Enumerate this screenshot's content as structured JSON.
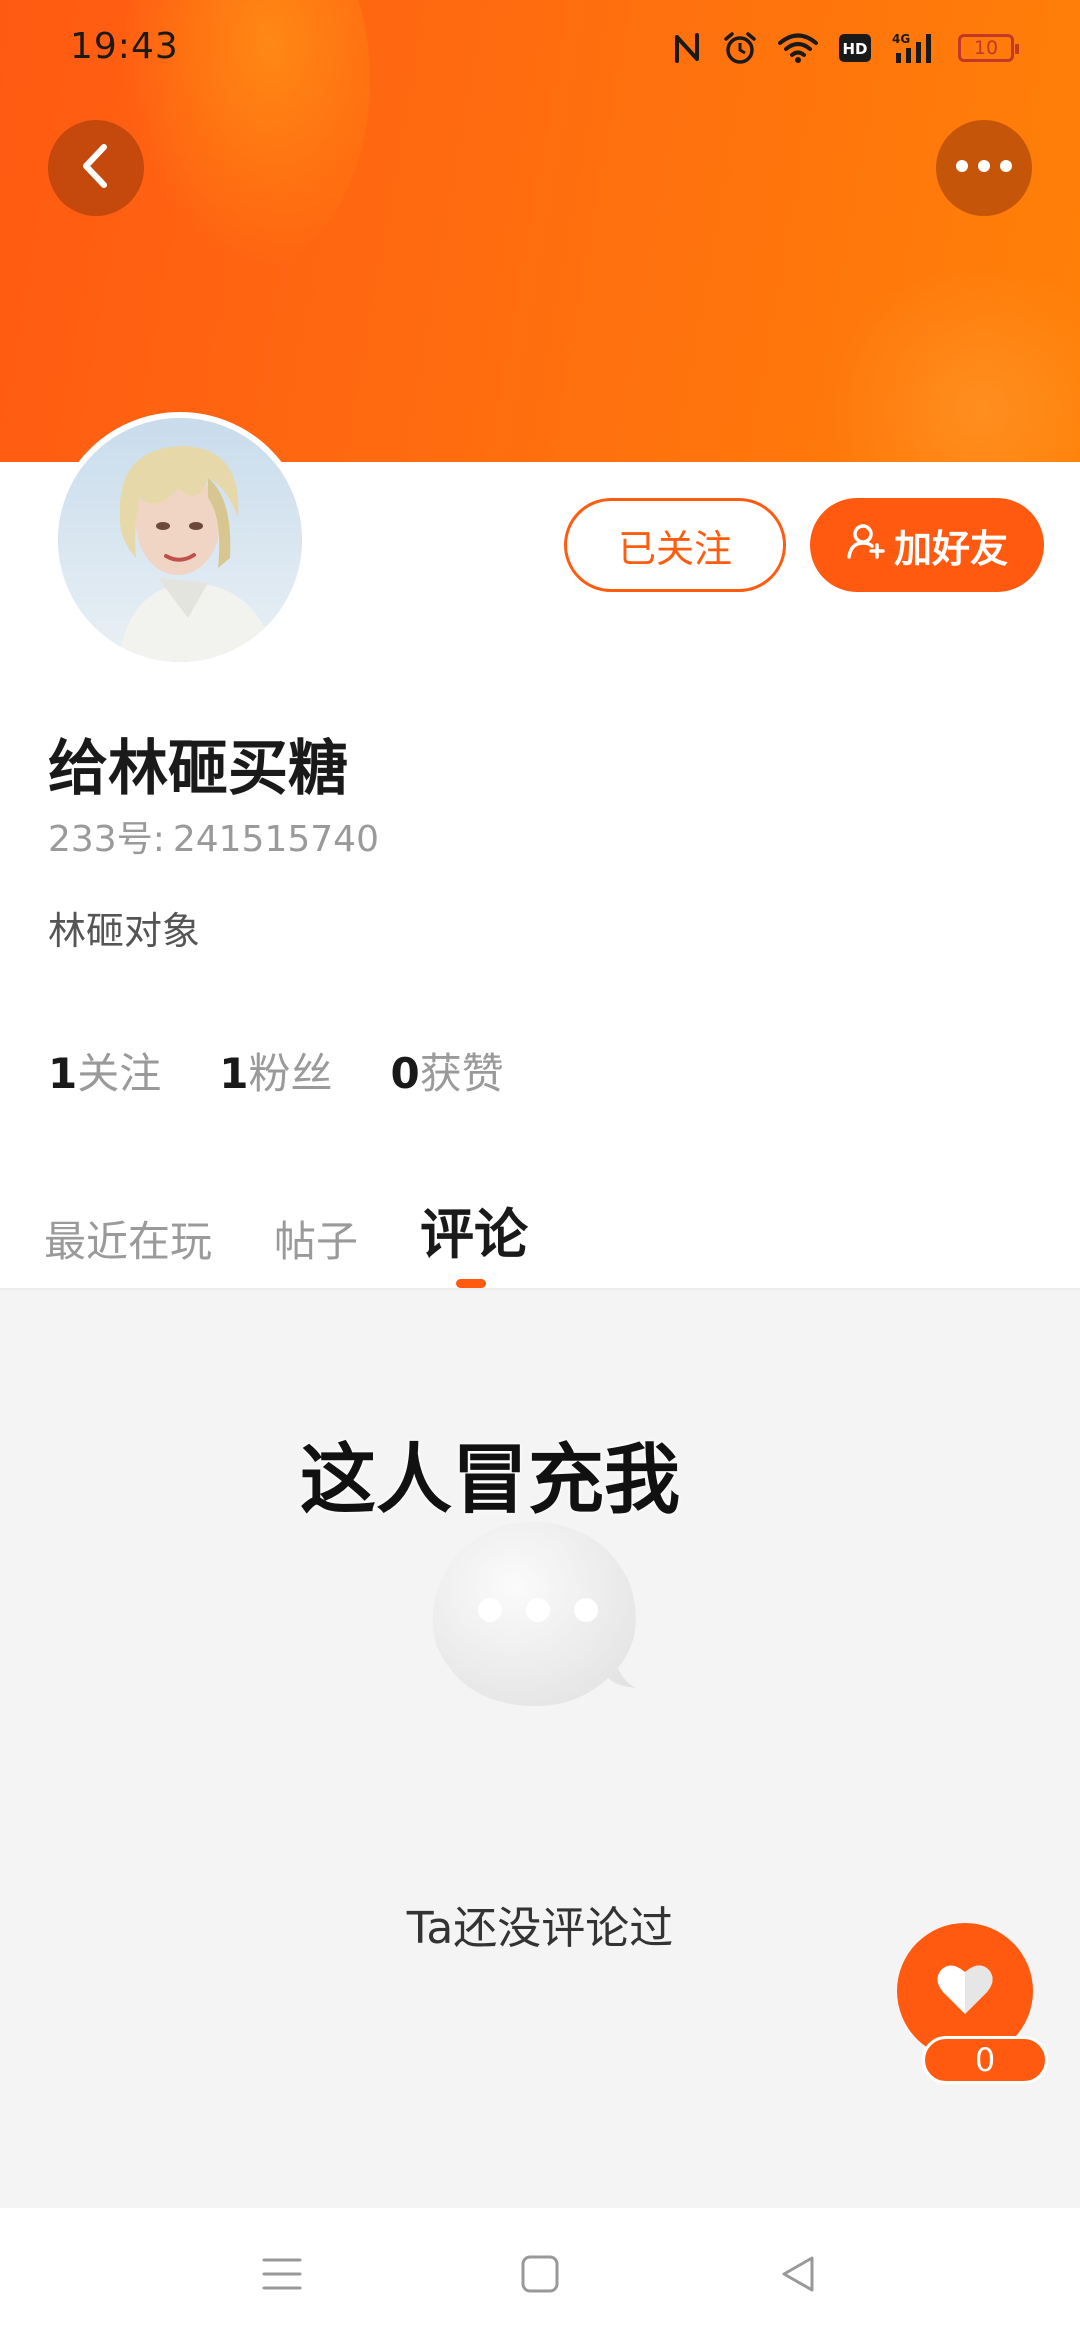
{
  "status_bar": {
    "time": "19:43",
    "battery": "10",
    "icons": [
      "nfc-icon",
      "alarm-icon",
      "wifi-icon",
      "hd-icon",
      "signal-4g-icon",
      "battery-icon"
    ]
  },
  "header": {
    "back_icon": "chevron-left-icon",
    "more_icon": "more-dots-icon",
    "banner_color": "#ff6a10"
  },
  "profile": {
    "username": "给林砸买糖",
    "id_label": "233号:",
    "id_value": "241515740",
    "bio": "林砸对象",
    "follow_button": "已关注",
    "add_friend_button": "加好友",
    "accent_color": "#ff5a10"
  },
  "stats": [
    {
      "value": "1",
      "label": "关注"
    },
    {
      "value": "1",
      "label": "粉丝"
    },
    {
      "value": "0",
      "label": "获赞"
    }
  ],
  "tabs": [
    {
      "label": "最近在玩",
      "active": false
    },
    {
      "label": "帖子",
      "active": false
    },
    {
      "label": "评论",
      "active": true
    }
  ],
  "content": {
    "overlay_text": "这人冒充我",
    "empty_icon": "chat-bubble-icon",
    "empty_text": "Ta还没评论过"
  },
  "like": {
    "icon": "heart-icon",
    "count": "0"
  },
  "nav_bar": {
    "icons": [
      "menu-icon",
      "home-square-icon",
      "back-triangle-icon"
    ]
  }
}
